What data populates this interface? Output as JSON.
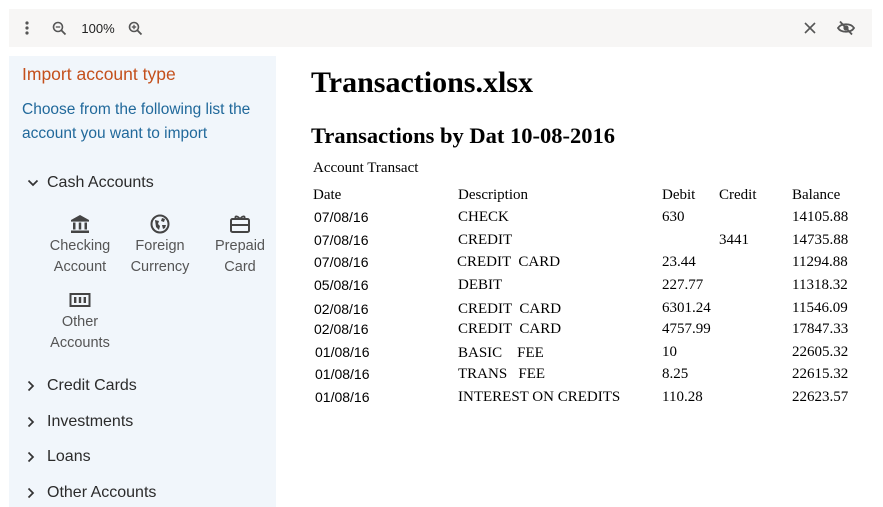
{
  "toolbar": {
    "menu_icon": "more-vert-icon",
    "zoom_out_icon": "zoom-out-icon",
    "zoom_level": "100%",
    "zoom_in_icon": "zoom-in-icon",
    "close_icon": "close-icon",
    "visibility_icon": "visibility-off-icon"
  },
  "sidebar": {
    "title": "Import account type",
    "description": "Choose from the following list the account you want to import",
    "categories": [
      {
        "label": "Cash Accounts",
        "expanded": true
      },
      {
        "label": "Credit Cards",
        "expanded": false
      },
      {
        "label": "Investments",
        "expanded": false
      },
      {
        "label": "Loans",
        "expanded": false
      },
      {
        "label": "Other Accounts",
        "expanded": false
      }
    ],
    "cash_items": [
      {
        "line1": "Checking",
        "line2": "Account",
        "icon": "bank-icon"
      },
      {
        "line1": "Foreign",
        "line2": "Currency",
        "icon": "globe-icon"
      },
      {
        "line1": "Prepaid",
        "line2": "Card",
        "icon": "gift-card-icon"
      },
      {
        "line1": "Other",
        "line2": "Accounts",
        "icon": "cash-icon"
      }
    ],
    "colors": {
      "title": "#c4501c",
      "description": "#21699b",
      "background": "#f1f6fb"
    }
  },
  "document": {
    "title": "Transactions.xlsx",
    "subtitle": "Transactions by Dat 10-08-2016",
    "caption": "Account Transact",
    "headers": [
      "Date",
      "Description",
      "Debit",
      "Credit",
      "Balance"
    ],
    "rows": [
      {
        "date": "07/08/16",
        "description": "CHECK",
        "debit": "630",
        "credit": "",
        "balance": "14105.88"
      },
      {
        "date": "07/08/16",
        "description": "CREDIT",
        "debit": "",
        "credit": "3441",
        "balance": "14735.88"
      },
      {
        "date": "07/08/16",
        "description": "CREDIT  CARD",
        "debit": "23.44",
        "credit": "",
        "balance": "11294.88"
      },
      {
        "date": "05/08/16",
        "description": "DEBIT",
        "debit": "227.77",
        "credit": "",
        "balance": "11318.32"
      },
      {
        "date": "02/08/16",
        "description": "CREDIT  CARD",
        "debit": "6301.24",
        "credit": "",
        "balance": "11546.09"
      },
      {
        "date": "02/08/16",
        "description": "CREDIT  CARD",
        "debit": "4757.99",
        "credit": "",
        "balance": "17847.33"
      },
      {
        "date": "01/08/16",
        "description": "BASIC    FEE",
        "debit": "10",
        "credit": "",
        "balance": "22605.32"
      },
      {
        "date": "01/08/16",
        "description": "TRANS   FEE",
        "debit": "8.25",
        "credit": "",
        "balance": "22615.32"
      },
      {
        "date": "01/08/16",
        "description": "INTEREST ON CREDITS",
        "debit": "110.28",
        "credit": "",
        "balance": "22623.57"
      }
    ]
  }
}
